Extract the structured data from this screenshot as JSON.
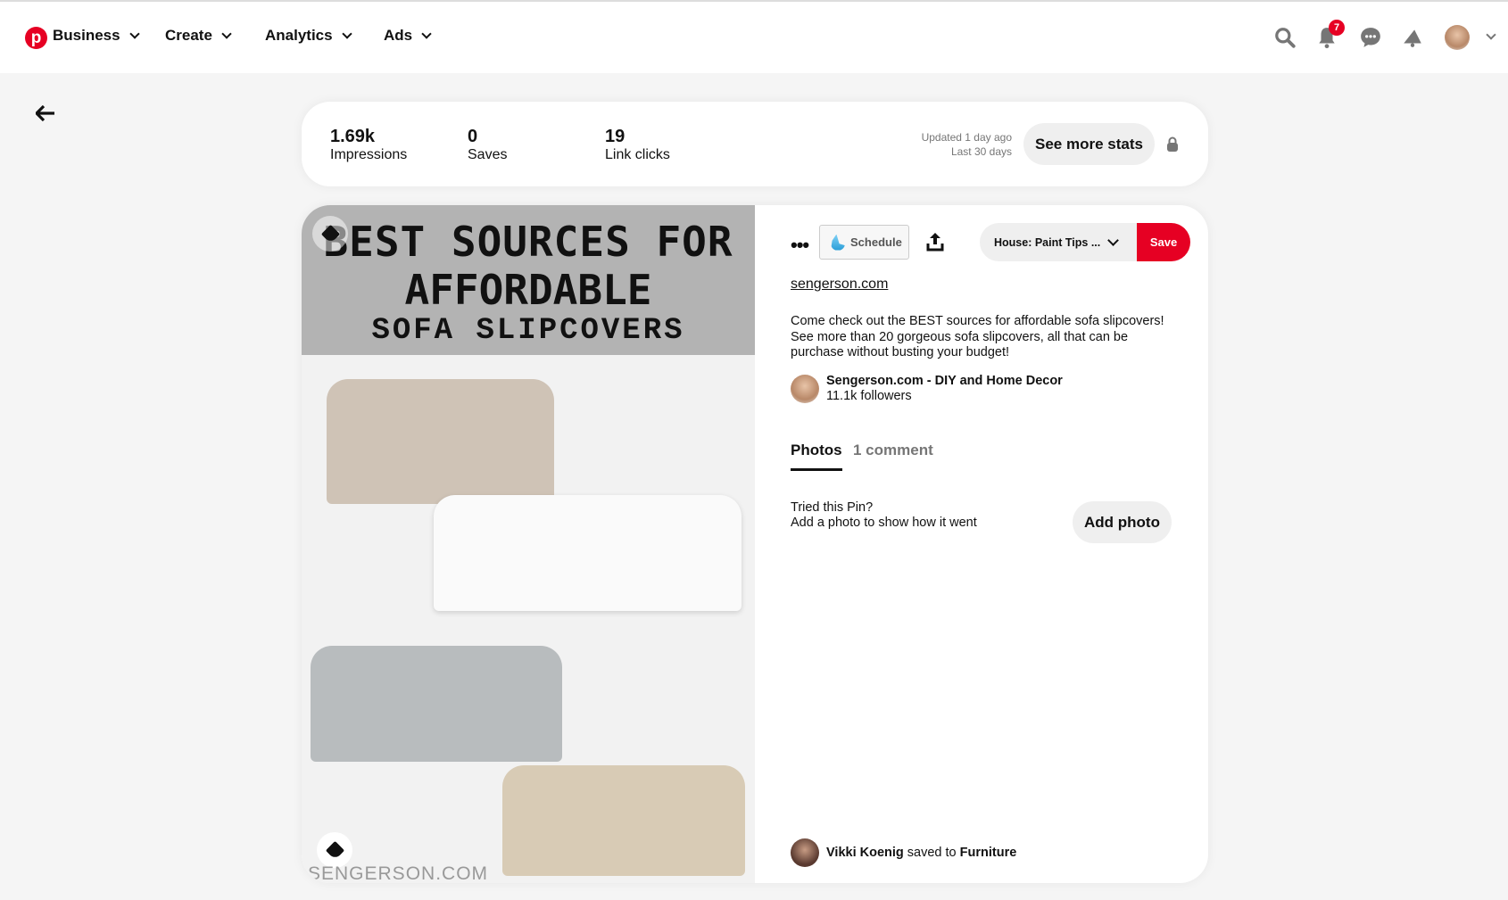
{
  "nav": {
    "items": [
      {
        "label": "Business"
      },
      {
        "label": "Create"
      },
      {
        "label": "Analytics"
      },
      {
        "label": "Ads"
      }
    ],
    "notifications_count": "7",
    "brand_color": "#e60023"
  },
  "stats": {
    "items": [
      {
        "value": "1.69k",
        "label": "Impressions"
      },
      {
        "value": "0",
        "label": "Saves"
      },
      {
        "value": "19",
        "label": "Link clicks"
      }
    ],
    "updated": "Updated 1 day ago",
    "range": "Last 30 days",
    "see_more": "See more stats"
  },
  "pin": {
    "image": {
      "line1": "BEST SOURCES FOR",
      "line2": "AFFORDABLE",
      "line3": "SOFA SLIPCOVERS",
      "watermark": "SENGERSON.COM"
    },
    "schedule_label": "Schedule",
    "board": "House: Paint Tips ...",
    "save_label": "Save",
    "link": "sengerson.com",
    "description": "Come check out the BEST sources for affordable sofa slipcovers! See more than 20 gorgeous sofa slipcovers, all that can be purchase without busting your budget!",
    "author": {
      "name": "Sengerson.com - DIY and Home Decor",
      "followers": "11.1k followers"
    },
    "tabs": [
      {
        "label": "Photos",
        "active": true
      },
      {
        "label": "1 comment",
        "active": false
      }
    ],
    "tried": {
      "title": "Tried this Pin?",
      "subtitle": "Add a photo to show how it went",
      "button": "Add photo"
    },
    "saved_by": {
      "user": "Vikki Koenig",
      "verb": "saved to",
      "board": "Furniture"
    }
  }
}
